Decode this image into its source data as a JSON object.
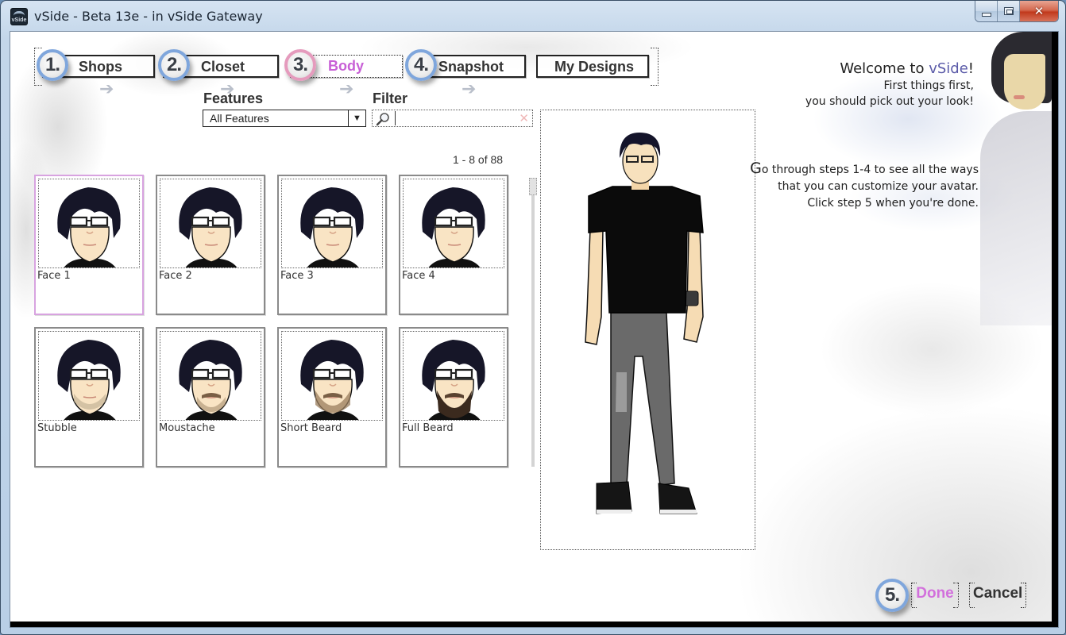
{
  "window": {
    "title": "vSide - Beta 13e - in vSide Gateway",
    "app_icon_label": "vSide",
    "controls": {
      "minimize": "minimize",
      "maximize": "maximize",
      "close": "✕"
    }
  },
  "steps": [
    {
      "number": "1.",
      "label": "Shops",
      "active": false
    },
    {
      "number": "2.",
      "label": "Closet",
      "active": false
    },
    {
      "number": "3.",
      "label": "Body",
      "active": true
    },
    {
      "number": "4.",
      "label": "Snapshot",
      "active": false
    }
  ],
  "my_designs_label": "My Designs",
  "step_arrow_glyph": "➔",
  "features": {
    "label": "Features",
    "selected": "All Features",
    "dropdown_glyph": "▼"
  },
  "filter": {
    "label": "Filter",
    "value": "",
    "placeholder": "",
    "clear_glyph": "✕"
  },
  "paging": "1 - 8 of 88",
  "items": [
    {
      "name": "Face 1",
      "selected": true,
      "beard": "none"
    },
    {
      "name": "Face 2",
      "selected": false,
      "beard": "none"
    },
    {
      "name": "Face 3",
      "selected": false,
      "beard": "none"
    },
    {
      "name": "Face 4",
      "selected": false,
      "beard": "none"
    },
    {
      "name": "Stubble",
      "selected": false,
      "beard": "stubble"
    },
    {
      "name": "Moustache",
      "selected": false,
      "beard": "moustache"
    },
    {
      "name": "Short Beard",
      "selected": false,
      "beard": "short"
    },
    {
      "name": "Full Beard",
      "selected": false,
      "beard": "full"
    }
  ],
  "welcome": {
    "line1_prefix": "Welcome to ",
    "brand": "vSide",
    "line1_suffix": "!",
    "line2": "First things first,",
    "line3": "you should pick out your look!"
  },
  "instructions": {
    "first_letter": "G",
    "line1_rest": "o through steps 1-4 to see all the ways",
    "line2": "that you can customize your avatar.",
    "line3": "Click step 5 when you're done."
  },
  "footer": {
    "step_number": "5.",
    "done_label": "Done",
    "cancel_label": "Cancel"
  },
  "colors": {
    "accent_active": "#c860d6",
    "badge_ring": "#7fa6dc",
    "badge_ring_active": "#e59bbd",
    "selected_border": "#d8a3e0",
    "brand": "#5a5aa8"
  }
}
